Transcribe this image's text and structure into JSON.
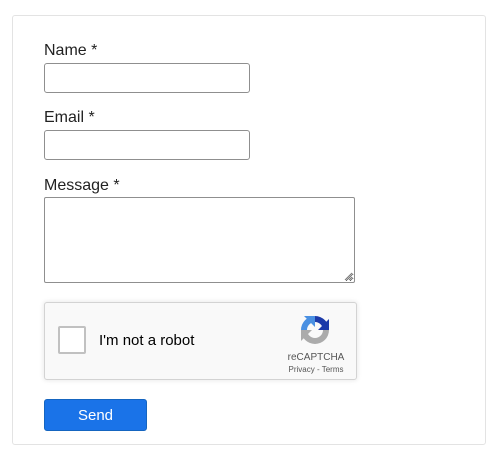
{
  "form": {
    "name_label": "Name *",
    "name_value": "",
    "email_label": "Email *",
    "email_value": "",
    "message_label": "Message *",
    "message_value": "",
    "submit_label": "Send"
  },
  "recaptcha": {
    "checkbox_label": "I'm not a robot",
    "brand": "reCAPTCHA",
    "privacy_link": "Privacy",
    "separator": " - ",
    "terms_link": "Terms",
    "logo_icon": "recaptcha-logo-icon",
    "checked": false
  },
  "colors": {
    "button_bg": "#1a73e8",
    "logo_blue": "#1c3aa9",
    "logo_light_blue": "#4a90e2",
    "logo_gray": "#ababab"
  }
}
